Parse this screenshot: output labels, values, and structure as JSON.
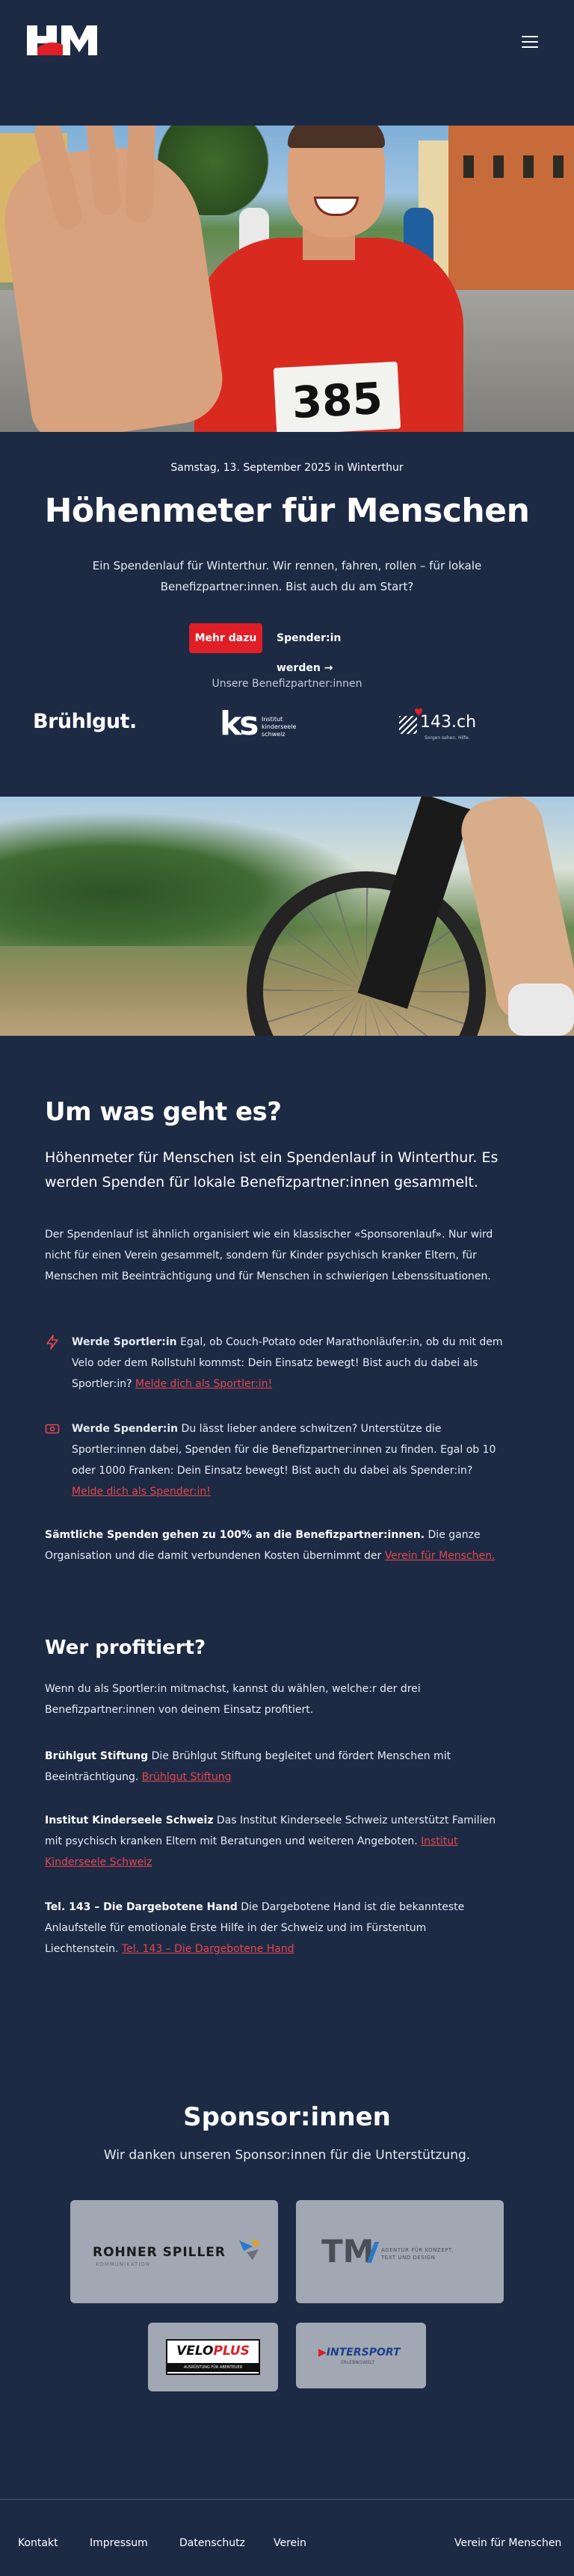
{
  "header": {
    "logo_alt": "HM",
    "menu_icon": "hamburger-menu-icon"
  },
  "hero": {
    "bib_number": "385",
    "date": "Samstag, 13. September 2025 in Winterthur",
    "title": "Höhenmeter für Menschen",
    "lead": "Ein Spendenlauf für Winterthur. Wir rennen, fahren, rollen – für lokale Benefizpartner:innen. Bist auch du am Start?",
    "btn_more": "Mehr dazu",
    "btn_donor": "Spender:in werden →",
    "partners_caption": "Unsere Benefizpartner:innen",
    "partners": {
      "bruehlgut": "Brühlgut.",
      "ks_mark": "ks",
      "ks_text": "Institut\nkinderseele\nschweiz",
      "tel143": "143.ch",
      "tel143_sub": "Sorgen sehen. Hilfe."
    }
  },
  "about": {
    "title": "Um was geht es?",
    "lead": "Höhenmeter für Menschen ist ein Spendenlauf in Winterthur. Es werden Spenden für lokale Benefizpartner:innen gesammelt.",
    "intro": "Der Spendenlauf ist ähnlich organisiert wie ein klassischer «Sponsorenlauf». Nur wird nicht für einen Verein gesammelt, sondern für Kinder psychisch kranker Eltern, für Menschen mit Beeinträchtigung und für Menschen in schwierigen Lebenssituationen.",
    "sportler": {
      "icon": "lightning-icon",
      "bold": "Werde Sportler:in",
      "text": " Egal, ob Couch-Potato oder Marathonläufer:in, ob du mit dem Velo oder dem Rollstuhl kommst: Dein Einsatz bewegt! Bist auch du dabei als Sportler:in? ",
      "link": "Melde dich als Sportler:in!"
    },
    "spender": {
      "icon": "money-icon",
      "bold": "Werde Spender:in",
      "text": " Du lässt lieber andere schwitzen? Unterstütze die Sportler:innen dabei, Spenden für die Benefizpartner:innen zu finden. Egal ob 10 oder 1000 Franken: Dein Einsatz bewegt! Bist auch du dabei als Spender:in? ",
      "link": "Melde dich als Spender:in!"
    },
    "all_bold": "Sämtliche Spenden gehen zu 100% an die Benefizpartner:innen.",
    "all_text": " Die ganze Organisation und die damit verbundenen Kosten übernimmt der ",
    "all_link": "Verein für Menschen."
  },
  "benefit": {
    "title": "Wer profitiert?",
    "intro": "Wenn du als Sportler:in mitmachst, kannst du wählen, welche:r der drei Benefizpartner:innen von deinem Einsatz profitiert.",
    "p1_bold": "Brühlgut Stiftung",
    "p1_text": " Die Brühlgut Stiftung begleitet und fördert Menschen mit Beeinträchtigung. ",
    "p1_link": "Brühlgut Stiftung",
    "p2_bold": "Institut Kinderseele Schweiz",
    "p2_text": " Das Institut Kinderseele Schweiz unterstützt Familien mit psychisch kranken Eltern mit Beratungen und weiteren Angeboten. ",
    "p2_link": "Institut Kinderseele Schweiz",
    "p3_bold": "Tel. 143 – Die Dargebotene Hand",
    "p3_text": " Die Dargebotene Hand ist die bekannteste Anlaufstelle für emotionale Erste Hilfe in der Schweiz und im Fürstentum Liechtenstein. ",
    "p3_link": "Tel. 143 – Die Dargebotene Hand"
  },
  "sponsors": {
    "title": "Sponsor:innen",
    "subtitle": "Wir danken unseren Sponsor:innen für die Unterstützung.",
    "rohner_name": "ROHNER SPILLER",
    "rohner_sub": "KOMMUNIKATION",
    "tm_mark": "TM",
    "tm_sub": "AGENTUR FÜR KONZEPT,\nTEXT UND DESIGN",
    "veloplus_a": "VELO",
    "veloplus_b": "PLUS",
    "veloplus_sub": "AUSRÜSTUNG FÜR ABENTEUER",
    "intersport_a": "INTER",
    "intersport_b": "SPORT",
    "intersport_sub": "ERLEBNISWELT"
  },
  "footer": {
    "kontakt": "Kontakt",
    "impressum": "Impressum",
    "datenschutz": "Datenschutz",
    "verein": "Verein",
    "verein_right": "Verein für Menschen"
  },
  "colors": {
    "background": "#1c2a44",
    "accent_red": "#e01e26",
    "link_red": "#e5474d",
    "card_gray": "#a1a8b3"
  }
}
